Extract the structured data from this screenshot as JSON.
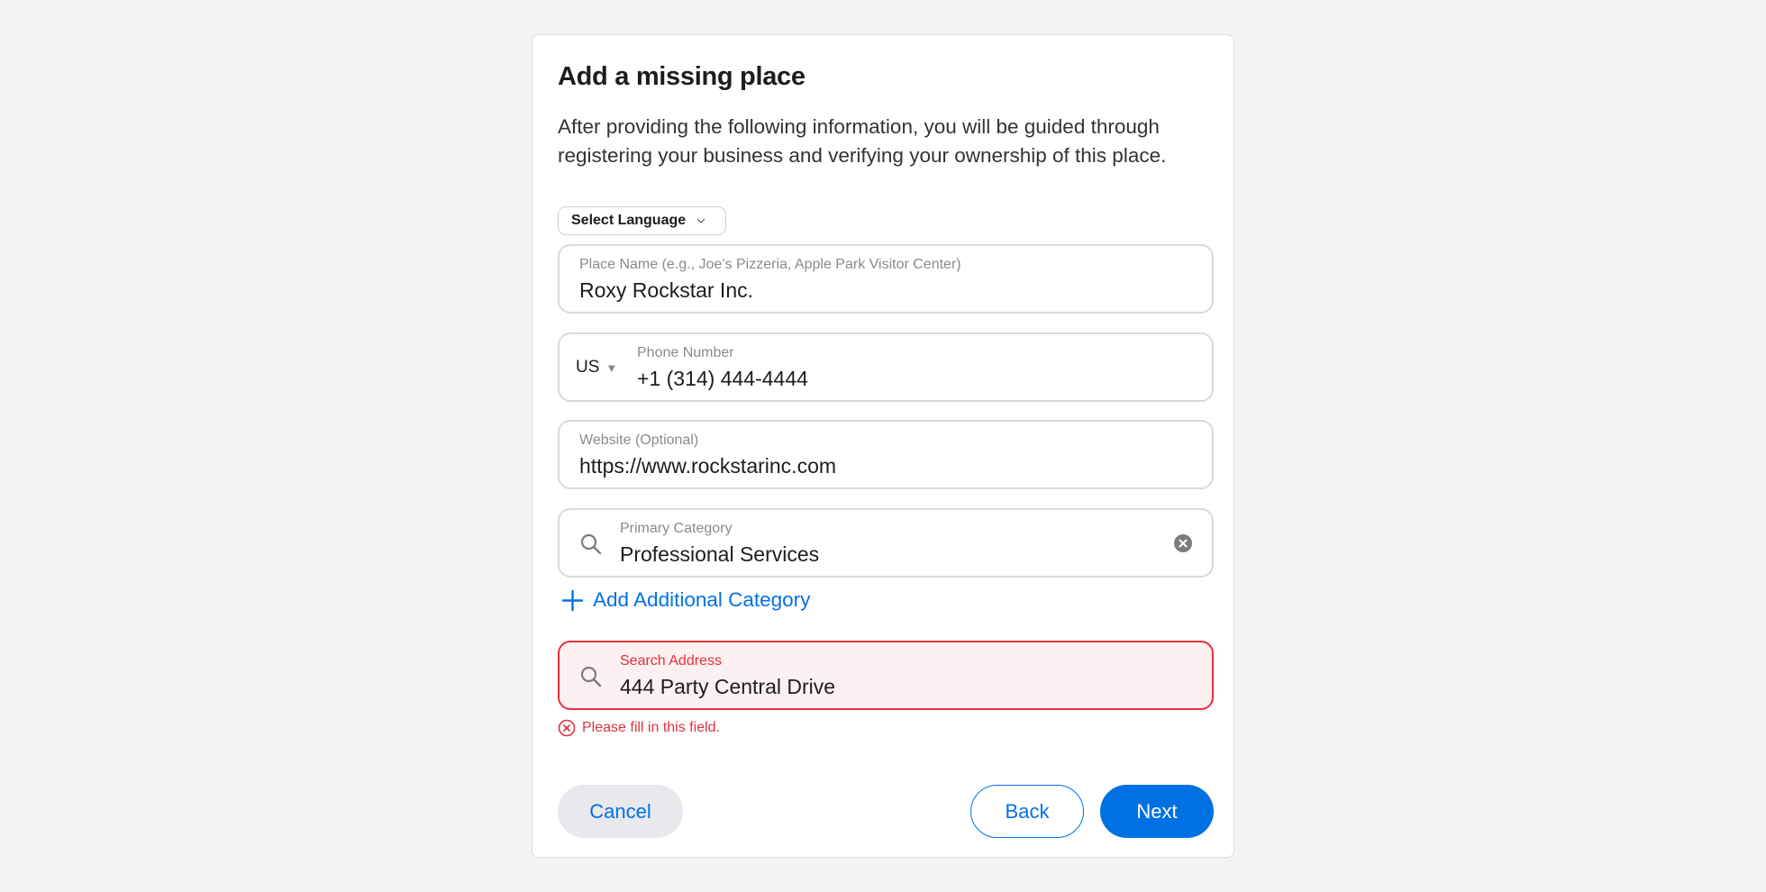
{
  "dialog": {
    "title": "Add a missing place",
    "description": "After providing the following information, you will be guided through registering your business and verifying your ownership of this place."
  },
  "language_select": {
    "label": "Select Language",
    "icon": "chevron-down-icon"
  },
  "fields": {
    "place_name": {
      "label": "Place Name (e.g., Joe’s Pizzeria, Apple Park Visitor Center)",
      "value": "Roxy Rockstar Inc."
    },
    "phone": {
      "country": "US",
      "country_icon": "triangle-down-icon",
      "label": "Phone Number",
      "value": "+1 (314) 444-4444"
    },
    "website": {
      "label": "Website (Optional)",
      "value": "https://www.rockstarinc.com"
    },
    "primary_category": {
      "label": "Primary Category",
      "value": "Professional Services",
      "icon": "search-icon",
      "clear_icon": "clear-icon"
    },
    "address": {
      "label": "Search Address",
      "value": "444 Party Central Drive",
      "icon": "search-icon",
      "state": "error",
      "error_message": "Please fill in this field."
    }
  },
  "add_category": {
    "label": "Add Additional Category",
    "icon": "plus-icon"
  },
  "buttons": {
    "cancel": "Cancel",
    "back": "Back",
    "next": "Next"
  },
  "colors": {
    "accent": "#0071e3",
    "error": "#e3313a",
    "error_background": "#fdf0f2",
    "page_background": "#f2f3f5"
  }
}
